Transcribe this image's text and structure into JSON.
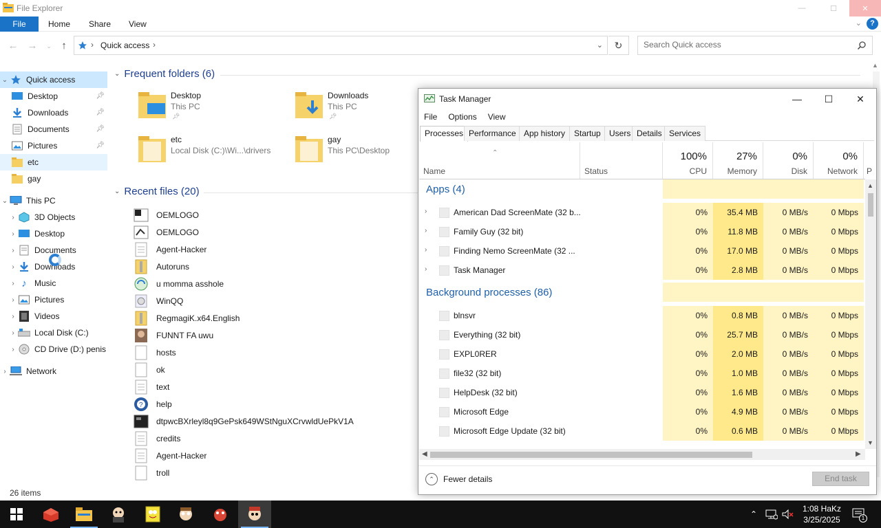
{
  "explorer": {
    "title": "File Explorer",
    "ribbon": {
      "file": "File",
      "home": "Home",
      "share": "Share",
      "view": "View",
      "help": "?"
    },
    "address": {
      "crumb": "Quick access"
    },
    "search": {
      "placeholder": "Search Quick access"
    },
    "nav": {
      "quick_access": "Quick access",
      "pinned": [
        "Desktop",
        "Downloads",
        "Documents",
        "Pictures"
      ],
      "recent_folders": [
        "etc",
        "gay"
      ],
      "this_pc": "This PC",
      "pc_items": [
        "3D Objects",
        "Desktop",
        "Documents",
        "Downloads",
        "Music",
        "Pictures",
        "Videos",
        "Local Disk (C:)",
        "CD Drive (D:) penis"
      ],
      "network": "Network"
    },
    "frequent": {
      "header": "Frequent folders (6)",
      "folders": [
        {
          "name": "Desktop",
          "location": "This PC"
        },
        {
          "name": "Downloads",
          "location": "This PC"
        },
        {
          "name": "etc",
          "location": "Local Disk (C:)\\Wi...\\drivers"
        },
        {
          "name": "gay",
          "location": "This PC\\Desktop"
        }
      ]
    },
    "recent": {
      "header": "Recent files (20)",
      "files": [
        "OEMLOGO",
        "OEMLOGO",
        "Agent-Hacker",
        "Autoruns",
        "u momma asshole",
        "WinQQ",
        "RegmagiK.x64.English",
        "FUNNT FA uwu",
        "hosts",
        "ok",
        "text",
        "help",
        "dtpwcBXrleyl8q9GePsk649WStNguXCrvwldUePkV1A",
        "credits",
        "Agent-Hacker",
        "troll"
      ]
    },
    "status": "26 items"
  },
  "taskmgr": {
    "title": "Task Manager",
    "menu": [
      "File",
      "Options",
      "View"
    ],
    "tabs": [
      "Processes",
      "Performance",
      "App history",
      "Startup",
      "Users",
      "Details",
      "Services"
    ],
    "columns": {
      "name": "Name",
      "status": "Status",
      "cpu_pct": "100%",
      "cpu": "CPU",
      "mem_pct": "27%",
      "mem": "Memory",
      "disk_pct": "0%",
      "disk": "Disk",
      "net_pct": "0%",
      "net": "Network",
      "extra": "P"
    },
    "apps_header": "Apps (4)",
    "apps": [
      {
        "name": "American Dad ScreenMate (32 b...",
        "cpu": "0%",
        "mem": "35.4 MB",
        "disk": "0 MB/s",
        "net": "0 Mbps"
      },
      {
        "name": "Family Guy (32 bit)",
        "cpu": "0%",
        "mem": "11.8 MB",
        "disk": "0 MB/s",
        "net": "0 Mbps"
      },
      {
        "name": "Finding Nemo ScreenMate (32 ...",
        "cpu": "0%",
        "mem": "17.0 MB",
        "disk": "0 MB/s",
        "net": "0 Mbps"
      },
      {
        "name": "Task Manager",
        "cpu": "0%",
        "mem": "2.8 MB",
        "disk": "0 MB/s",
        "net": "0 Mbps"
      }
    ],
    "bg_header": "Background processes (86)",
    "background": [
      {
        "name": "blnsvr",
        "cpu": "0%",
        "mem": "0.8 MB",
        "disk": "0 MB/s",
        "net": "0 Mbps"
      },
      {
        "name": "Everything (32 bit)",
        "cpu": "0%",
        "mem": "25.7 MB",
        "disk": "0 MB/s",
        "net": "0 Mbps"
      },
      {
        "name": "EXPL0RER",
        "cpu": "0%",
        "mem": "2.0 MB",
        "disk": "0 MB/s",
        "net": "0 Mbps"
      },
      {
        "name": "file32 (32 bit)",
        "cpu": "0%",
        "mem": "1.0 MB",
        "disk": "0 MB/s",
        "net": "0 Mbps"
      },
      {
        "name": "HelpDesk (32 bit)",
        "cpu": "0%",
        "mem": "1.6 MB",
        "disk": "0 MB/s",
        "net": "0 Mbps"
      },
      {
        "name": "Microsoft Edge",
        "cpu": "0%",
        "mem": "4.9 MB",
        "disk": "0 MB/s",
        "net": "0 Mbps"
      },
      {
        "name": "Microsoft Edge Update (32 bit)",
        "cpu": "0%",
        "mem": "0.6 MB",
        "disk": "0 MB/s",
        "net": "0 Mbps"
      }
    ],
    "fewer_details": "Fewer details",
    "end_task": "End task"
  },
  "taskbar": {
    "time": "1:08 HaKz",
    "date": "3/25/2025",
    "notification_count": "1"
  },
  "colors": {
    "accent": "#1a73c7",
    "taskbar": "#111111",
    "cpu_heat": "#fff4c4",
    "mem_heat": "#ffe98a"
  }
}
